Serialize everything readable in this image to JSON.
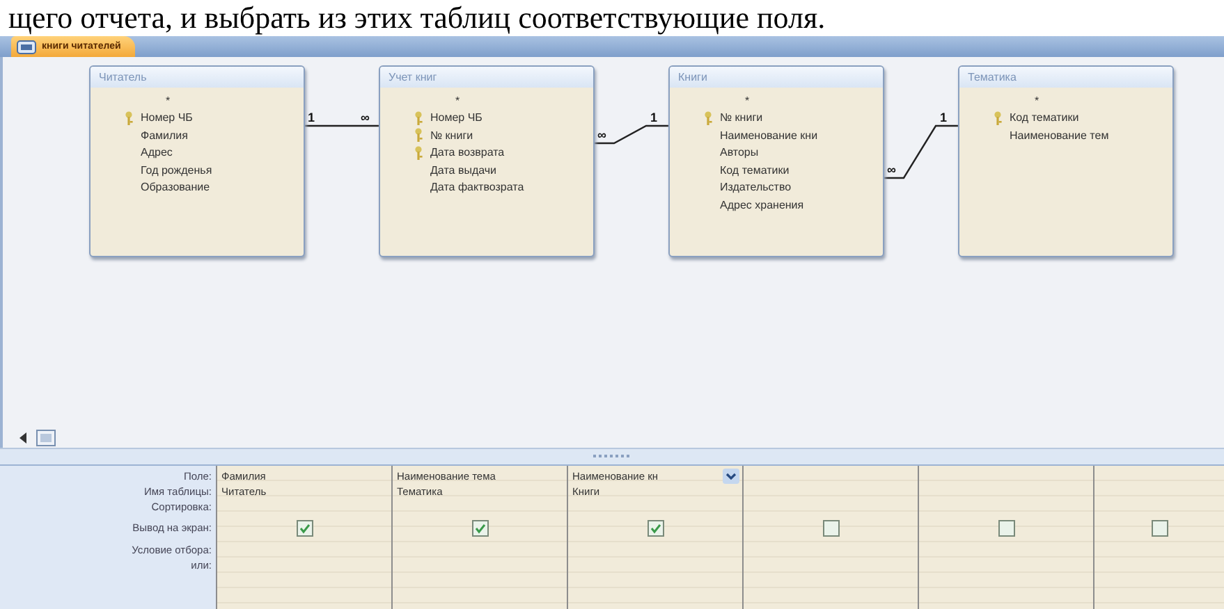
{
  "document_text": "щего отчета, и выбрать из этих таблиц соответствующие поля.",
  "tab": {
    "label": "книги читателей",
    "selected": true
  },
  "tables": [
    {
      "title": "Читатель",
      "fields": [
        {
          "name": "*",
          "key": false
        },
        {
          "name": "Номер ЧБ",
          "key": true
        },
        {
          "name": "Фамилия",
          "key": false
        },
        {
          "name": "Адрес",
          "key": false
        },
        {
          "name": "Год рожденья",
          "key": false
        },
        {
          "name": "Образование",
          "key": false
        }
      ]
    },
    {
      "title": "Учет книг",
      "fields": [
        {
          "name": "*",
          "key": false
        },
        {
          "name": "Номер ЧБ",
          "key": true
        },
        {
          "name": "№ книги",
          "key": true
        },
        {
          "name": "Дата возврата",
          "key": true
        },
        {
          "name": "Дата выдачи",
          "key": false
        },
        {
          "name": "Дата фактвозрата",
          "key": false
        }
      ]
    },
    {
      "title": "Книги",
      "fields": [
        {
          "name": "*",
          "key": false
        },
        {
          "name": "№ книги",
          "key": true
        },
        {
          "name": "Наименование кни",
          "key": false
        },
        {
          "name": "Авторы",
          "key": false
        },
        {
          "name": "Код тематики",
          "key": false
        },
        {
          "name": "Издательство",
          "key": false
        },
        {
          "name": "Адрес хранения",
          "key": false
        }
      ]
    },
    {
      "title": "Тематика",
      "fields": [
        {
          "name": "*",
          "key": false
        },
        {
          "name": "Код тематики",
          "key": true
        },
        {
          "name": "Наименование тем",
          "key": false
        }
      ]
    }
  ],
  "relations": [
    {
      "one_mark": "1",
      "many_mark": "∞"
    },
    {
      "one_mark": "1",
      "many_mark": "∞"
    },
    {
      "one_mark": "1",
      "many_mark": "∞"
    }
  ],
  "grid": {
    "row_labels": [
      "Поле:",
      "Имя таблицы:",
      "Сортировка:",
      "Вывод на экран:",
      "Условие отбора:",
      "или:"
    ],
    "columns": [
      {
        "field": "Фамилия",
        "table": "Читатель",
        "show": true,
        "dropdown": false
      },
      {
        "field": "Наименование тема",
        "table": "Тематика",
        "show": true,
        "dropdown": false
      },
      {
        "field": "Наименование кн",
        "table": "Книги",
        "show": true,
        "dropdown": true
      },
      {
        "show": false,
        "dropdown": false
      },
      {
        "show": false,
        "dropdown": false
      },
      {
        "show": false,
        "dropdown": false
      }
    ]
  }
}
